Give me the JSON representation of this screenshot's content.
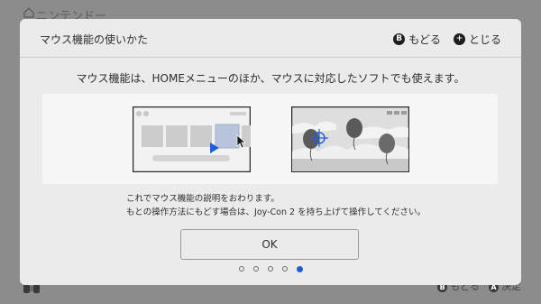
{
  "background": {
    "title": "ニンテンドー",
    "footer_back_glyph": "B",
    "footer_back": "もどる",
    "footer_confirm_glyph": "A",
    "footer_confirm": "決定"
  },
  "dialog": {
    "title": "マウス機能の使いかた",
    "back_glyph": "B",
    "back_label": "もどる",
    "close_glyph": "+",
    "close_label": "とじる",
    "description": "マウス機能は、HOMEメニューのほか、マウスに対応したソフトでも使えます。",
    "info_line1": "これでマウス機能の説明をおわります。",
    "info_line2": "もとの操作方法にもどす場合は、Joy-Con 2 を持ち上げて操作してください。",
    "ok_label": "OK",
    "pager": {
      "total": 5,
      "current": 5
    }
  },
  "colors": {
    "accent": "#1f5fd6",
    "dialog_bg": "#ebebeb"
  }
}
